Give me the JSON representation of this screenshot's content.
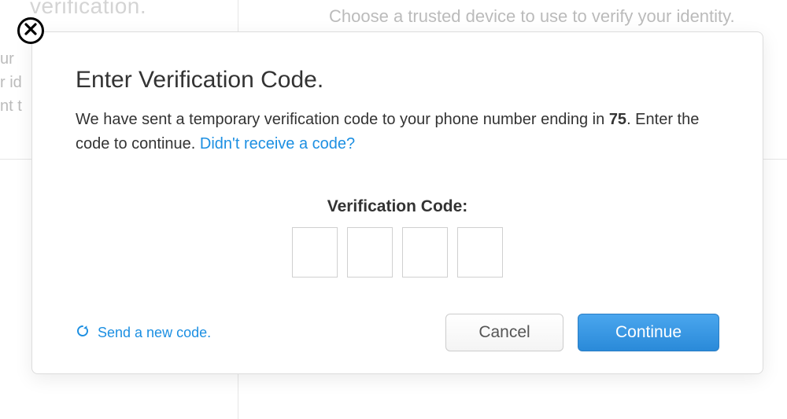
{
  "background": {
    "title_fragment": "verification.",
    "right_fragment": "Choose a trusted device to use to verify your identity.",
    "left_fragment": "ur\nr id\nnt t"
  },
  "modal": {
    "title": "Enter Verification Code.",
    "desc_part1": "We have sent a temporary verification code to your phone number ending in ",
    "phone_last_digits": "75",
    "desc_part2": ". Enter the code to continue. ",
    "no_code_link": "Didn't receive a code?",
    "code_label": "Verification Code:",
    "code_length": 4,
    "resend_label": "Send a new code.",
    "cancel_label": "Cancel",
    "continue_label": "Continue"
  }
}
